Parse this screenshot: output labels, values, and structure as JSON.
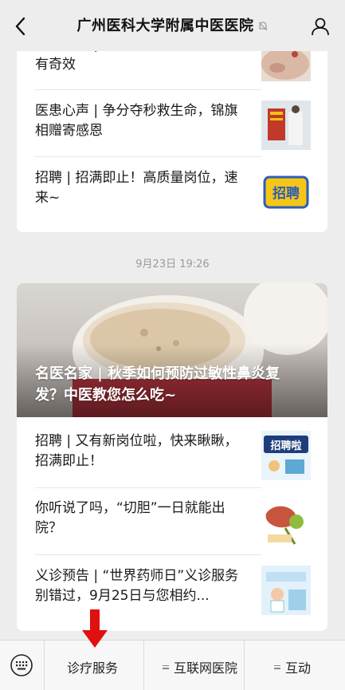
{
  "header": {
    "title": "广州医科大学附属中医医院"
  },
  "card1": {
    "items": [
      {
        "title": "名医名家 | 寻臊疹顽固难愈，针灸有奇效"
      },
      {
        "title": "医患心声 | 争分夺秒救生命，锦旗相赠寄感恩"
      },
      {
        "title": "招聘 | 招满即止！高质量岗位，速来~"
      }
    ]
  },
  "timestamp": "9月23日 19:26",
  "card2": {
    "hero_title": "名医名家 | 秋季如何预防过敏性鼻炎复发？中医教您怎么吃~",
    "items": [
      {
        "title": "招聘 | 又有新岗位啦，快来瞅瞅，招满即止！",
        "thumb_text": "招聘啦"
      },
      {
        "title": "你听说了吗，“切胆”一日就能出院？"
      },
      {
        "title": "义诊预告 | “世界药师日”义诊服务别错过，9月25日与您相约..."
      }
    ]
  },
  "thumb_label_recruit": "招聘",
  "bottom_menu": {
    "items": [
      "诊疗服务",
      "互联网医院",
      "互动"
    ]
  },
  "colors": {
    "background": "#ededed",
    "card": "#ffffff",
    "arrow": "#e01010"
  }
}
